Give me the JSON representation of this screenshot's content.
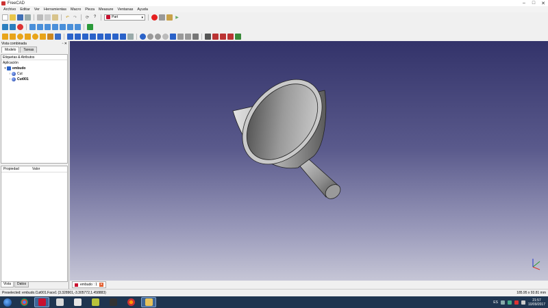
{
  "window": {
    "title": "FreeCAD"
  },
  "menu": [
    "Archivo",
    "Editar",
    "Ver",
    "Herramientas",
    "Macro",
    "Pieza",
    "Measure",
    "Ventanas",
    "Ayuda"
  ],
  "toolbar": {
    "workbench": "Part"
  },
  "combo": {
    "title": "Vista combinada",
    "tabs": [
      "Modelo",
      "Tareas"
    ],
    "tree_header": "Etiquetas & Atributos",
    "tree": [
      {
        "label": "Aplicación",
        "depth": 0
      },
      {
        "label": "embudo",
        "depth": 1
      },
      {
        "label": "Cut",
        "depth": 2
      },
      {
        "label": "Cut001",
        "depth": 2
      }
    ],
    "props_columns": [
      "Propiedad",
      "Valor"
    ],
    "bottom_tabs": [
      "Vista",
      "Datos"
    ]
  },
  "document_tab": {
    "label": "embudo : 1"
  },
  "status": {
    "text": "Preselected: embudo.Cut001.Face1 (3.328901,-3.305772,1.458883)",
    "dimensions": "185.95 x 93.81 mm"
  },
  "taskbar": {
    "lang": "ES",
    "time": "21:57",
    "date": "10/09/2017"
  },
  "colors": {
    "viewport_top": "#33336a",
    "viewport_bottom": "#c6c6d6",
    "taskbar": "#1f3550",
    "accent": "#c8102e"
  }
}
